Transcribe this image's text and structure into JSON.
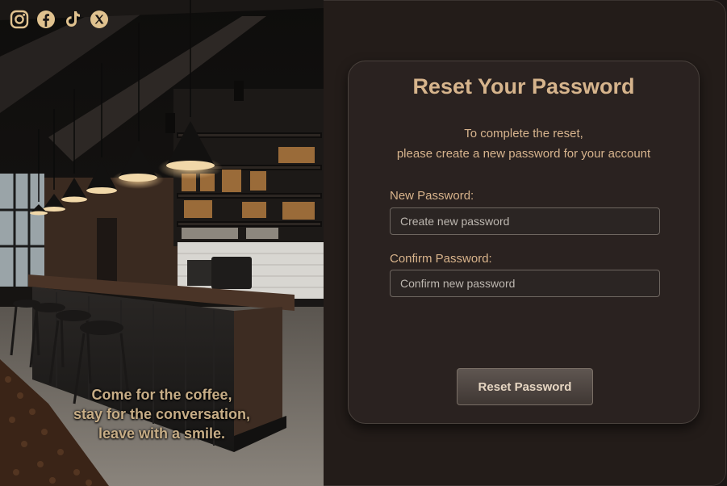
{
  "social": {
    "icons": [
      "instagram-icon",
      "facebook-icon",
      "tiktok-icon",
      "x-icon"
    ],
    "icon_color": "#e0c28f"
  },
  "tagline": {
    "line1": "Come for the coffee,",
    "line2": "stay for the conversation,",
    "line3": "leave with a smile."
  },
  "card": {
    "title": "Reset Your Password",
    "subtitle_line1": "To complete the reset,",
    "subtitle_line2": "please create a new password for your account",
    "new_password_label": "New Password:",
    "new_password_placeholder": "Create new password",
    "confirm_password_label": "Confirm Password:",
    "confirm_password_placeholder": "Confirm new password",
    "submit_label": "Reset Password"
  },
  "colors": {
    "accent": "#d6b48c",
    "panel": "#231c19",
    "card": "#2a2220"
  }
}
